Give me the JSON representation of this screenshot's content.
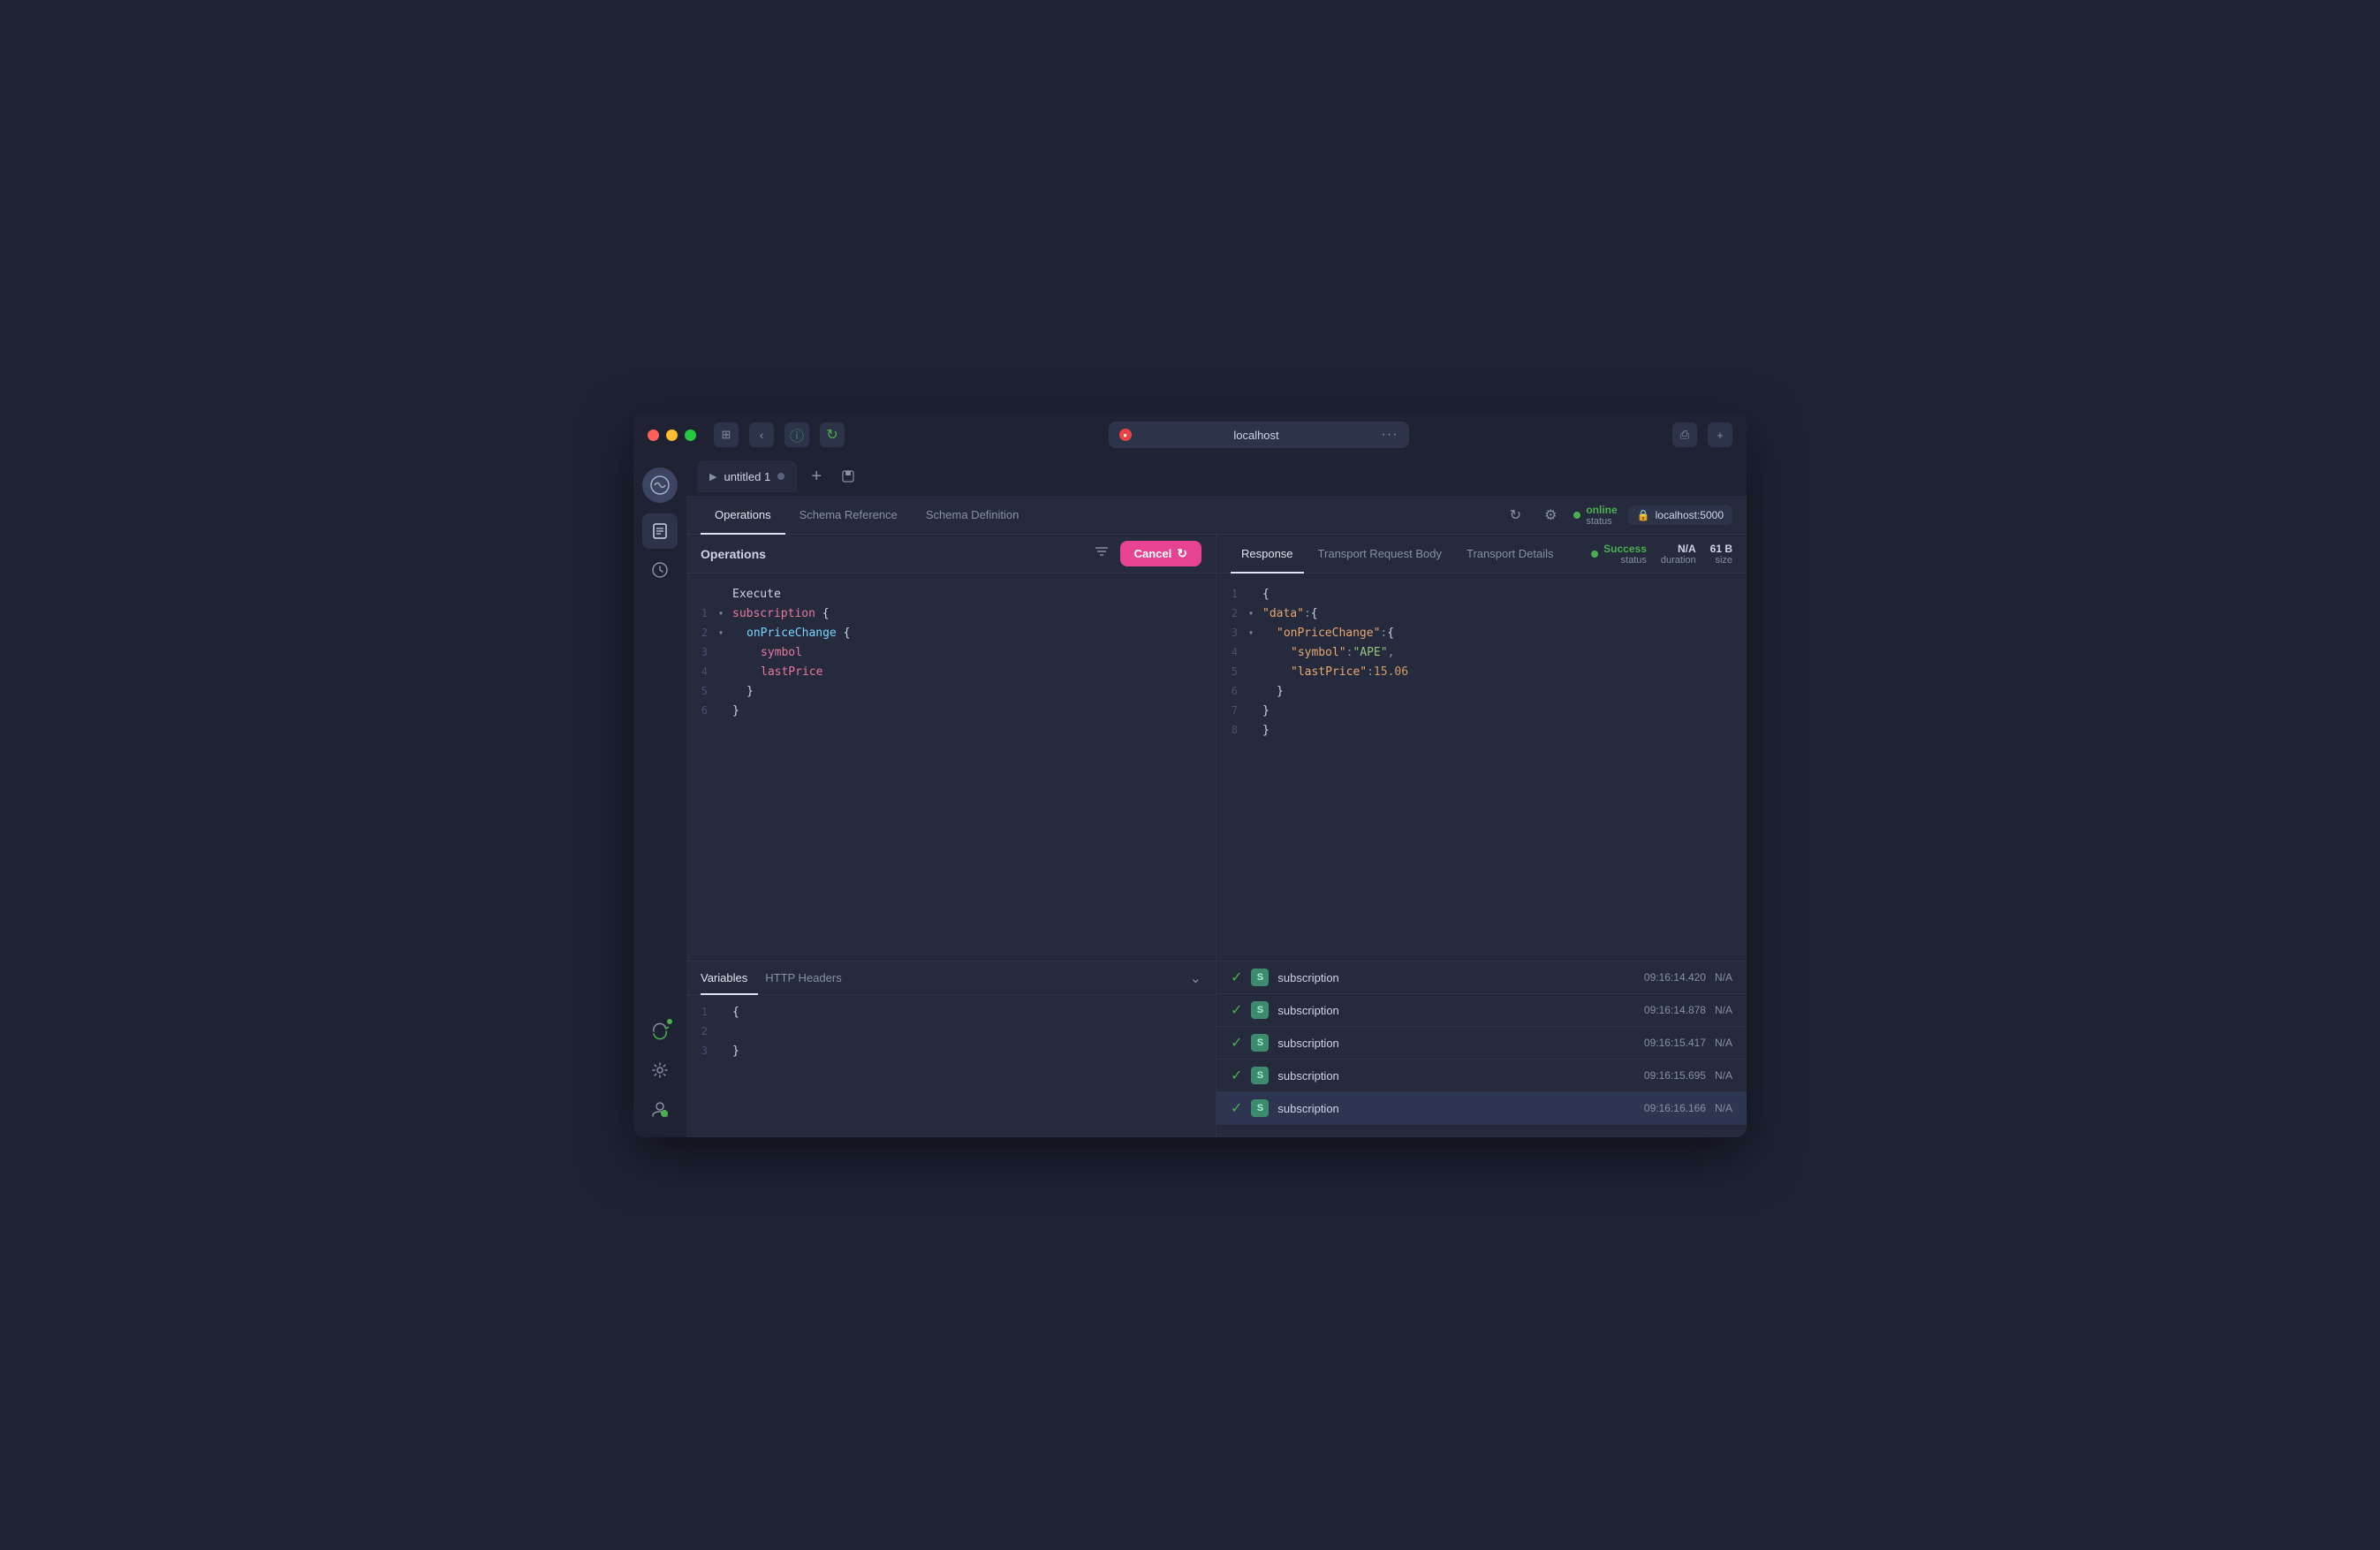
{
  "window": {
    "title": "localhost"
  },
  "titlebar": {
    "url": "localhost",
    "favicon": "🔴",
    "dots": "···"
  },
  "tabs": [
    {
      "label": "untitled 1",
      "active": true
    }
  ],
  "tab_add": "+",
  "tab_save": "⬜",
  "nav_tabs": [
    {
      "label": "Operations",
      "active": true
    },
    {
      "label": "Schema Reference",
      "active": false
    },
    {
      "label": "Schema Definition",
      "active": false
    }
  ],
  "online": {
    "dot_color": "#4caf50",
    "status": "online",
    "label": "status"
  },
  "server": {
    "label": "localhost:5000"
  },
  "left_panel": {
    "title": "Operations",
    "cancel_btn": "Cancel",
    "code_lines": [
      {
        "num": "",
        "indent": 0,
        "execute_label": "Execute"
      },
      {
        "num": "1",
        "chevron": "▾",
        "indent": 0,
        "content": "subscription {",
        "type": "subscription"
      },
      {
        "num": "2",
        "chevron": "▾",
        "indent": 1,
        "content": "onPriceChange {",
        "type": "onPriceChange"
      },
      {
        "num": "3",
        "indent": 2,
        "content": "symbol",
        "type": "field"
      },
      {
        "num": "4",
        "indent": 2,
        "content": "lastPrice",
        "type": "field"
      },
      {
        "num": "5",
        "indent": 1,
        "content": "}",
        "type": "brace"
      },
      {
        "num": "6",
        "indent": 0,
        "content": "}",
        "type": "brace"
      }
    ]
  },
  "right_panel": {
    "tabs": [
      {
        "label": "Response",
        "active": true
      },
      {
        "label": "Transport Request Body",
        "active": false
      },
      {
        "label": "Transport Details",
        "active": false
      }
    ],
    "status": "Success",
    "status_label": "status",
    "duration": "N/A",
    "duration_label": "duration",
    "size": "61 B",
    "size_label": "size",
    "json_lines": [
      {
        "num": "1",
        "content": "{",
        "type": "brace"
      },
      {
        "num": "2",
        "chevron": "▾",
        "content": "\"data\": {",
        "type": "key_brace",
        "key": "data"
      },
      {
        "num": "3",
        "chevron": "▾",
        "indent": 1,
        "content": "\"onPriceChange\": {",
        "type": "key_brace",
        "key": "onPriceChange"
      },
      {
        "num": "4",
        "indent": 2,
        "content": "\"symbol\": \"APE\",",
        "type": "key_string",
        "key": "symbol",
        "val": "APE"
      },
      {
        "num": "5",
        "indent": 2,
        "content": "\"lastPrice\": 15.06",
        "type": "key_number",
        "key": "lastPrice",
        "val": "15.06"
      },
      {
        "num": "6",
        "indent": 1,
        "content": "}",
        "type": "brace"
      },
      {
        "num": "7",
        "indent": 0,
        "content": "}",
        "type": "brace"
      },
      {
        "num": "8",
        "indent": 0,
        "content": "}",
        "type": "brace"
      }
    ]
  },
  "variables": {
    "tabs": [
      {
        "label": "Variables",
        "active": true
      },
      {
        "label": "HTTP Headers",
        "active": false
      }
    ],
    "code_lines": [
      {
        "num": "1",
        "content": "{"
      },
      {
        "num": "2",
        "content": ""
      },
      {
        "num": "3",
        "content": "}"
      }
    ]
  },
  "subscriptions": [
    {
      "name": "subscription",
      "time": "09:16:14.420",
      "na": "N/A",
      "highlighted": false
    },
    {
      "name": "subscription",
      "time": "09:16:14.878",
      "na": "N/A",
      "highlighted": false
    },
    {
      "name": "subscription",
      "time": "09:16:15.417",
      "na": "N/A",
      "highlighted": false
    },
    {
      "name": "subscription",
      "time": "09:16:15.695",
      "na": "N/A",
      "highlighted": false
    },
    {
      "name": "subscription",
      "time": "09:16:16.166",
      "na": "N/A",
      "highlighted": true
    }
  ]
}
